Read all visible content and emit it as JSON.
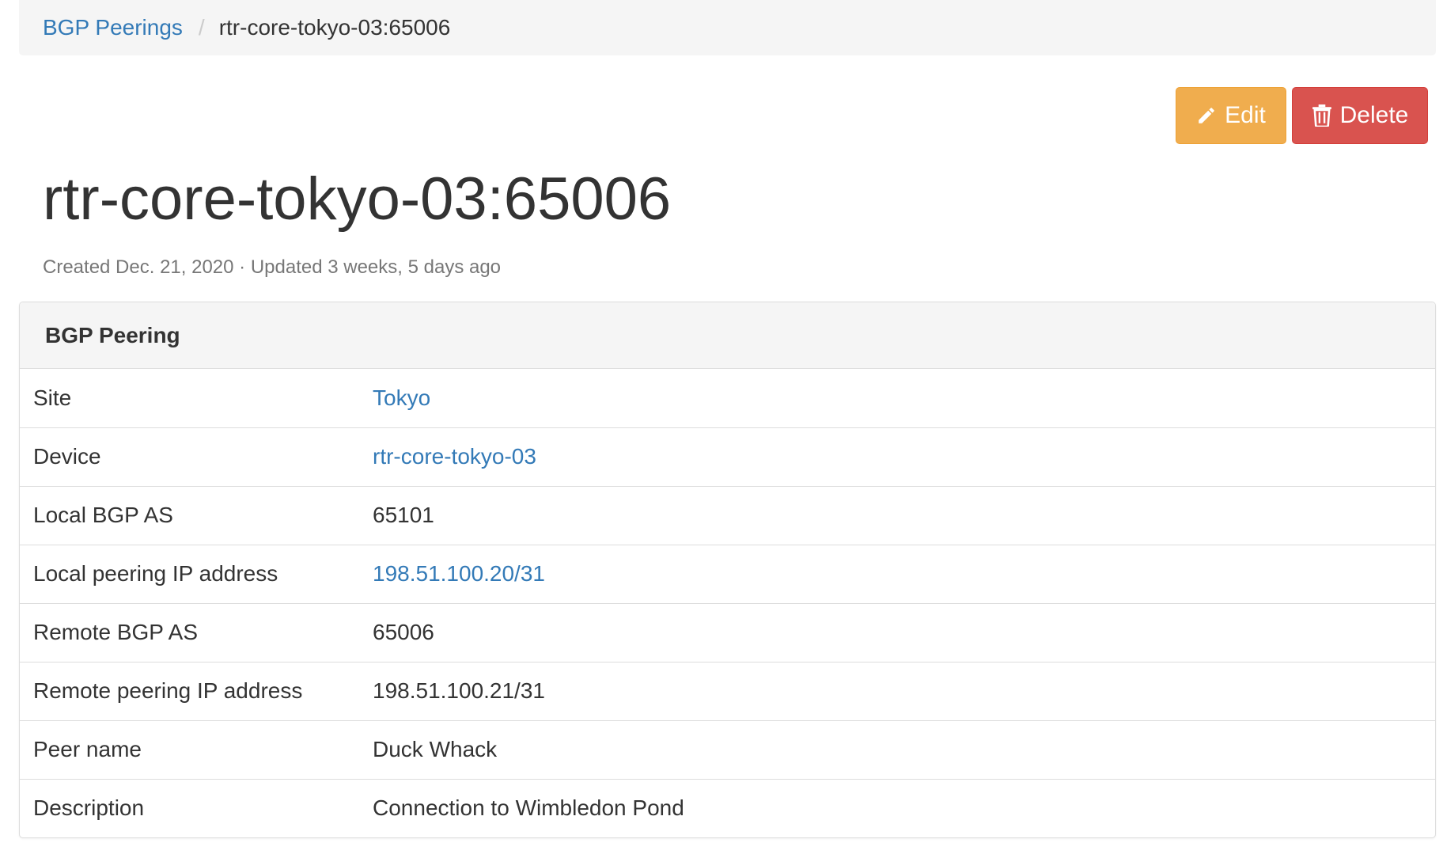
{
  "breadcrumb": {
    "parent": "BGP Peerings",
    "separator": "/",
    "current": "rtr-core-tokyo-03:65006"
  },
  "actions": {
    "edit_label": "Edit",
    "delete_label": "Delete",
    "edit_icon": "pencil-icon",
    "delete_icon": "trash-icon"
  },
  "page": {
    "title": "rtr-core-tokyo-03:65006",
    "meta": "Created Dec. 21, 2020 · Updated 3 weeks, 5 days ago"
  },
  "panel": {
    "heading": "BGP Peering",
    "rows": [
      {
        "label": "Site",
        "value": "Tokyo",
        "link": true
      },
      {
        "label": "Device",
        "value": "rtr-core-tokyo-03",
        "link": true
      },
      {
        "label": "Local BGP AS",
        "value": "65101",
        "link": false
      },
      {
        "label": "Local peering IP address",
        "value": "198.51.100.20/31",
        "link": true
      },
      {
        "label": "Remote BGP AS",
        "value": "65006",
        "link": false
      },
      {
        "label": "Remote peering IP address",
        "value": "198.51.100.21/31",
        "link": false
      },
      {
        "label": "Peer name",
        "value": "Duck Whack",
        "link": false
      },
      {
        "label": "Description",
        "value": "Connection to Wimbledon Pond",
        "link": false
      }
    ]
  },
  "colors": {
    "link": "#337ab7",
    "edit": "#f0ad4e",
    "delete": "#d9534f"
  }
}
